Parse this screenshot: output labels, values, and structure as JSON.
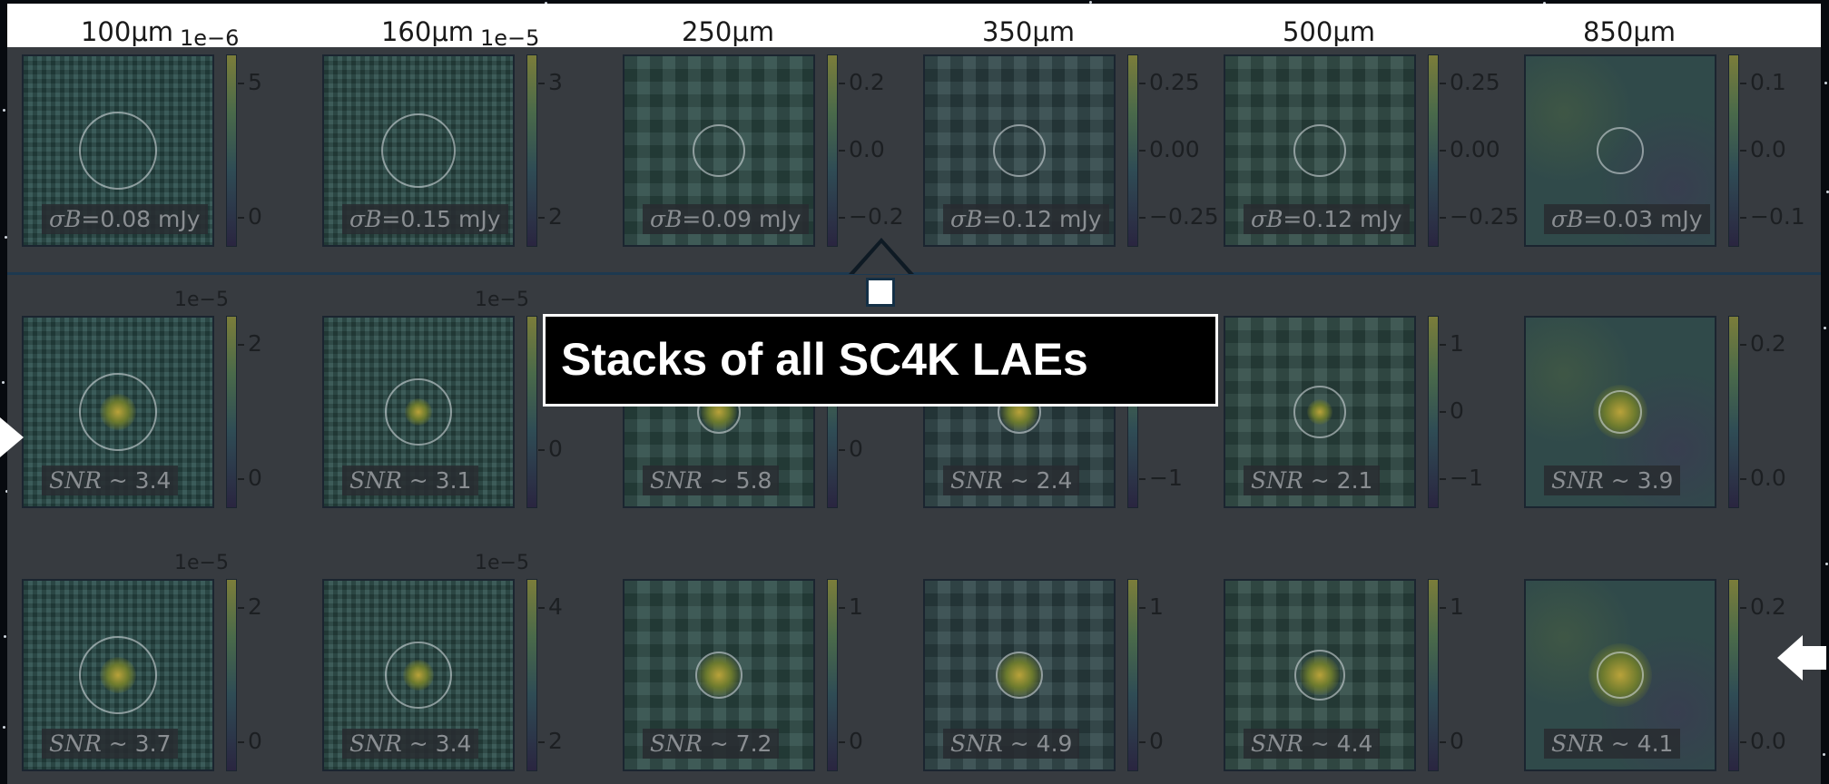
{
  "columns": [
    "100μm",
    "160μm",
    "250μm",
    "350μm",
    "500μm",
    "850μm"
  ],
  "row1_exponents": [
    "1e−6",
    "1e−5"
  ],
  "rows": [
    {
      "label_prefix": "σB=",
      "labels": [
        "0.08 mJy",
        "0.15 mJy",
        "0.09 mJy",
        "0.12 mJy",
        "0.12 mJy",
        "0.03 mJy"
      ],
      "exponents": [
        "",
        "",
        "",
        "",
        "",
        ""
      ],
      "ticks": [
        [
          "5",
          "0"
        ],
        [
          "3",
          "2"
        ],
        [
          "0.2",
          "0.0",
          "−0.2"
        ],
        [
          "0.25",
          "0.00",
          "−0.25"
        ],
        [
          "0.25",
          "0.00",
          "−0.25"
        ],
        [
          "0.1",
          "0.0",
          "−0.1"
        ]
      ]
    },
    {
      "label_prefix": "SNR ~ ",
      "labels": [
        "3.4",
        "3.1",
        "5.8",
        "2.4",
        "2.1",
        "3.9"
      ],
      "exponents": [
        "1e−5",
        "1e−5",
        "",
        "",
        "",
        ""
      ],
      "ticks": [
        [
          "2",
          "0"
        ],
        [
          "0"
        ],
        [
          "0"
        ],
        [
          "0",
          "−1"
        ],
        [
          "1",
          "0",
          "−1"
        ],
        [
          "0.2",
          "0.0"
        ]
      ]
    },
    {
      "label_prefix": "SNR ~ ",
      "labels": [
        "3.7",
        "3.4",
        "7.2",
        "4.9",
        "4.4",
        "4.1"
      ],
      "exponents": [
        "1e−5",
        "1e−5",
        "",
        "",
        "",
        ""
      ],
      "ticks": [
        [
          "2",
          "0"
        ],
        [
          "4",
          "2"
        ],
        [
          "1",
          "0"
        ],
        [
          "1",
          "0"
        ],
        [
          "1",
          "0"
        ],
        [
          "0.2",
          "0.0"
        ]
      ]
    }
  ],
  "callout": "Stacks of all SC4K LAEs"
}
